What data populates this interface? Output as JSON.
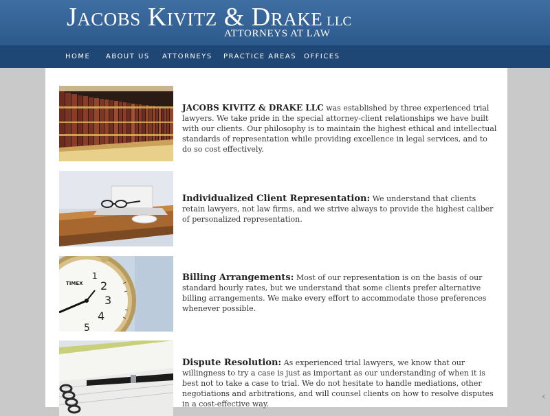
{
  "header": {
    "firm_name": "Jacobs Kivitz & Drake",
    "suffix": "LLC",
    "tagline": "ATTORNEYS AT LAW"
  },
  "nav": {
    "items": [
      {
        "label": "HOME"
      },
      {
        "label": "ABOUT US"
      },
      {
        "label": "ATTORNEYS"
      },
      {
        "label": "PRACTICE AREAS"
      },
      {
        "label": "OFFICES"
      }
    ]
  },
  "sections": [
    {
      "image": "law-books-photo",
      "lead": "JACOBS KIVITZ & DRAKE LLC",
      "body": " was established by three experienced trial lawyers. We take pride in the special attorney-client relationships we have built with our clients. Our philosophy is to maintain the highest ethical and intellectual standards of representation while providing excellence in legal services, and to do so cost effectively."
    },
    {
      "image": "laptop-desk-photo",
      "lead": "Individualized Client Representation:",
      "body": " We understand that clients retain lawyers, not law firms, and we strive always to provide the highest caliber of personalized representation."
    },
    {
      "image": "clock-photo",
      "lead": "Billing Arrangements:",
      "body": " Most of our representation is on the basis of our standard hourly rates, but we understand that some clients prefer alternative billing arrangements. We make every effort to accommodate those preferences whenever possible."
    },
    {
      "image": "notebook-pen-photo",
      "lead": "Dispute Resolution:",
      "body": " As experienced trial lawyers, we know that our willingness to try a case is just as important as our understanding of when it is best not to take a case to trial. We do not hesitate to handle mediations, other negotiations and arbitrations, and will counsel clients on how to resolve disputes in a cost-effective way."
    }
  ],
  "clock": {
    "brand": "TIMEX",
    "numbers": [
      "1",
      "2",
      "3",
      "4",
      "5"
    ]
  },
  "colors": {
    "header": "#2d5a8c",
    "nav": "#1f4775",
    "background": "#c9c9c9"
  }
}
